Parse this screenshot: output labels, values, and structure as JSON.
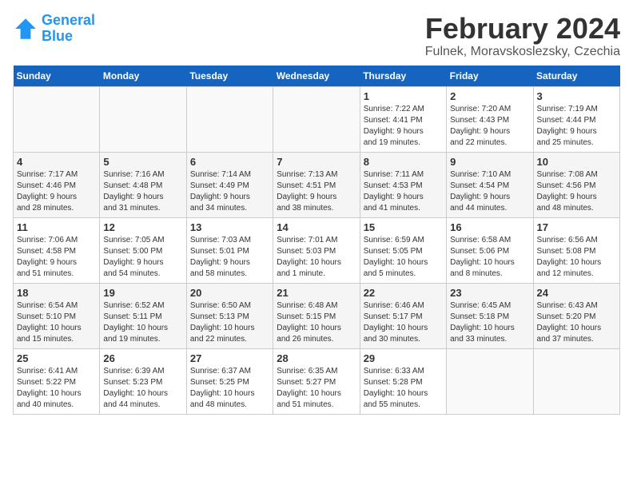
{
  "header": {
    "logo_line1": "General",
    "logo_line2": "Blue",
    "title": "February 2024",
    "subtitle": "Fulnek, Moravskoslezsky, Czechia"
  },
  "days_of_week": [
    "Sunday",
    "Monday",
    "Tuesday",
    "Wednesday",
    "Thursday",
    "Friday",
    "Saturday"
  ],
  "weeks": [
    [
      {
        "day": "",
        "info": ""
      },
      {
        "day": "",
        "info": ""
      },
      {
        "day": "",
        "info": ""
      },
      {
        "day": "",
        "info": ""
      },
      {
        "day": "1",
        "info": "Sunrise: 7:22 AM\nSunset: 4:41 PM\nDaylight: 9 hours\nand 19 minutes."
      },
      {
        "day": "2",
        "info": "Sunrise: 7:20 AM\nSunset: 4:43 PM\nDaylight: 9 hours\nand 22 minutes."
      },
      {
        "day": "3",
        "info": "Sunrise: 7:19 AM\nSunset: 4:44 PM\nDaylight: 9 hours\nand 25 minutes."
      }
    ],
    [
      {
        "day": "4",
        "info": "Sunrise: 7:17 AM\nSunset: 4:46 PM\nDaylight: 9 hours\nand 28 minutes."
      },
      {
        "day": "5",
        "info": "Sunrise: 7:16 AM\nSunset: 4:48 PM\nDaylight: 9 hours\nand 31 minutes."
      },
      {
        "day": "6",
        "info": "Sunrise: 7:14 AM\nSunset: 4:49 PM\nDaylight: 9 hours\nand 34 minutes."
      },
      {
        "day": "7",
        "info": "Sunrise: 7:13 AM\nSunset: 4:51 PM\nDaylight: 9 hours\nand 38 minutes."
      },
      {
        "day": "8",
        "info": "Sunrise: 7:11 AM\nSunset: 4:53 PM\nDaylight: 9 hours\nand 41 minutes."
      },
      {
        "day": "9",
        "info": "Sunrise: 7:10 AM\nSunset: 4:54 PM\nDaylight: 9 hours\nand 44 minutes."
      },
      {
        "day": "10",
        "info": "Sunrise: 7:08 AM\nSunset: 4:56 PM\nDaylight: 9 hours\nand 48 minutes."
      }
    ],
    [
      {
        "day": "11",
        "info": "Sunrise: 7:06 AM\nSunset: 4:58 PM\nDaylight: 9 hours\nand 51 minutes."
      },
      {
        "day": "12",
        "info": "Sunrise: 7:05 AM\nSunset: 5:00 PM\nDaylight: 9 hours\nand 54 minutes."
      },
      {
        "day": "13",
        "info": "Sunrise: 7:03 AM\nSunset: 5:01 PM\nDaylight: 9 hours\nand 58 minutes."
      },
      {
        "day": "14",
        "info": "Sunrise: 7:01 AM\nSunset: 5:03 PM\nDaylight: 10 hours\nand 1 minute."
      },
      {
        "day": "15",
        "info": "Sunrise: 6:59 AM\nSunset: 5:05 PM\nDaylight: 10 hours\nand 5 minutes."
      },
      {
        "day": "16",
        "info": "Sunrise: 6:58 AM\nSunset: 5:06 PM\nDaylight: 10 hours\nand 8 minutes."
      },
      {
        "day": "17",
        "info": "Sunrise: 6:56 AM\nSunset: 5:08 PM\nDaylight: 10 hours\nand 12 minutes."
      }
    ],
    [
      {
        "day": "18",
        "info": "Sunrise: 6:54 AM\nSunset: 5:10 PM\nDaylight: 10 hours\nand 15 minutes."
      },
      {
        "day": "19",
        "info": "Sunrise: 6:52 AM\nSunset: 5:11 PM\nDaylight: 10 hours\nand 19 minutes."
      },
      {
        "day": "20",
        "info": "Sunrise: 6:50 AM\nSunset: 5:13 PM\nDaylight: 10 hours\nand 22 minutes."
      },
      {
        "day": "21",
        "info": "Sunrise: 6:48 AM\nSunset: 5:15 PM\nDaylight: 10 hours\nand 26 minutes."
      },
      {
        "day": "22",
        "info": "Sunrise: 6:46 AM\nSunset: 5:17 PM\nDaylight: 10 hours\nand 30 minutes."
      },
      {
        "day": "23",
        "info": "Sunrise: 6:45 AM\nSunset: 5:18 PM\nDaylight: 10 hours\nand 33 minutes."
      },
      {
        "day": "24",
        "info": "Sunrise: 6:43 AM\nSunset: 5:20 PM\nDaylight: 10 hours\nand 37 minutes."
      }
    ],
    [
      {
        "day": "25",
        "info": "Sunrise: 6:41 AM\nSunset: 5:22 PM\nDaylight: 10 hours\nand 40 minutes."
      },
      {
        "day": "26",
        "info": "Sunrise: 6:39 AM\nSunset: 5:23 PM\nDaylight: 10 hours\nand 44 minutes."
      },
      {
        "day": "27",
        "info": "Sunrise: 6:37 AM\nSunset: 5:25 PM\nDaylight: 10 hours\nand 48 minutes."
      },
      {
        "day": "28",
        "info": "Sunrise: 6:35 AM\nSunset: 5:27 PM\nDaylight: 10 hours\nand 51 minutes."
      },
      {
        "day": "29",
        "info": "Sunrise: 6:33 AM\nSunset: 5:28 PM\nDaylight: 10 hours\nand 55 minutes."
      },
      {
        "day": "",
        "info": ""
      },
      {
        "day": "",
        "info": ""
      }
    ]
  ]
}
